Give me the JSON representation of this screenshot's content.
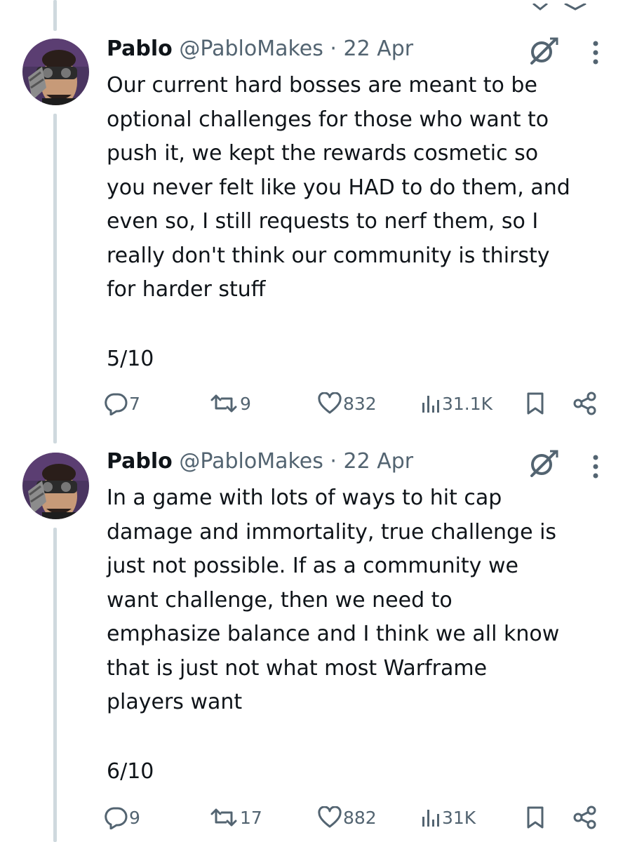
{
  "posts": [
    {
      "author_name": "Pablo",
      "handle": "@PabloMakes",
      "separator": "·",
      "date": "22 Apr",
      "text": "Our current hard bosses are meant to be\noptional challenges for those who want to\npush it, we kept the rewards cosmetic so\nyou never felt like you HAD to do them, and\neven so, I still requests to nerf them, so I\nreally don't think our community is thirsty\nfor harder stuff",
      "thread_index": "5/10",
      "replies": "7",
      "reposts": "9",
      "likes": "832",
      "views": "31.1K"
    },
    {
      "author_name": "Pablo",
      "handle": "@PabloMakes",
      "separator": "·",
      "date": "22 Apr",
      "text": "In a game with lots of ways to hit cap\ndamage and immortality, true challenge is\njust not possible. If as a community we\nwant challenge, then we need to\nemphasize balance and I think we all know\nthat is just not what most Warframe\nplayers want",
      "thread_index": "6/10",
      "replies": "9",
      "reposts": "17",
      "likes": "882",
      "views": "31K"
    }
  ],
  "icons": {
    "grok": "grok-icon",
    "more": "more-vertical-icon",
    "reply": "reply-icon",
    "repost": "repost-icon",
    "like": "heart-icon",
    "views": "analytics-icon",
    "bookmark": "bookmark-icon",
    "share": "share-icon"
  },
  "colors": {
    "text": "#0f1419",
    "secondary": "#536471",
    "thread_line": "#cfd9de",
    "background": "#ffffff"
  }
}
